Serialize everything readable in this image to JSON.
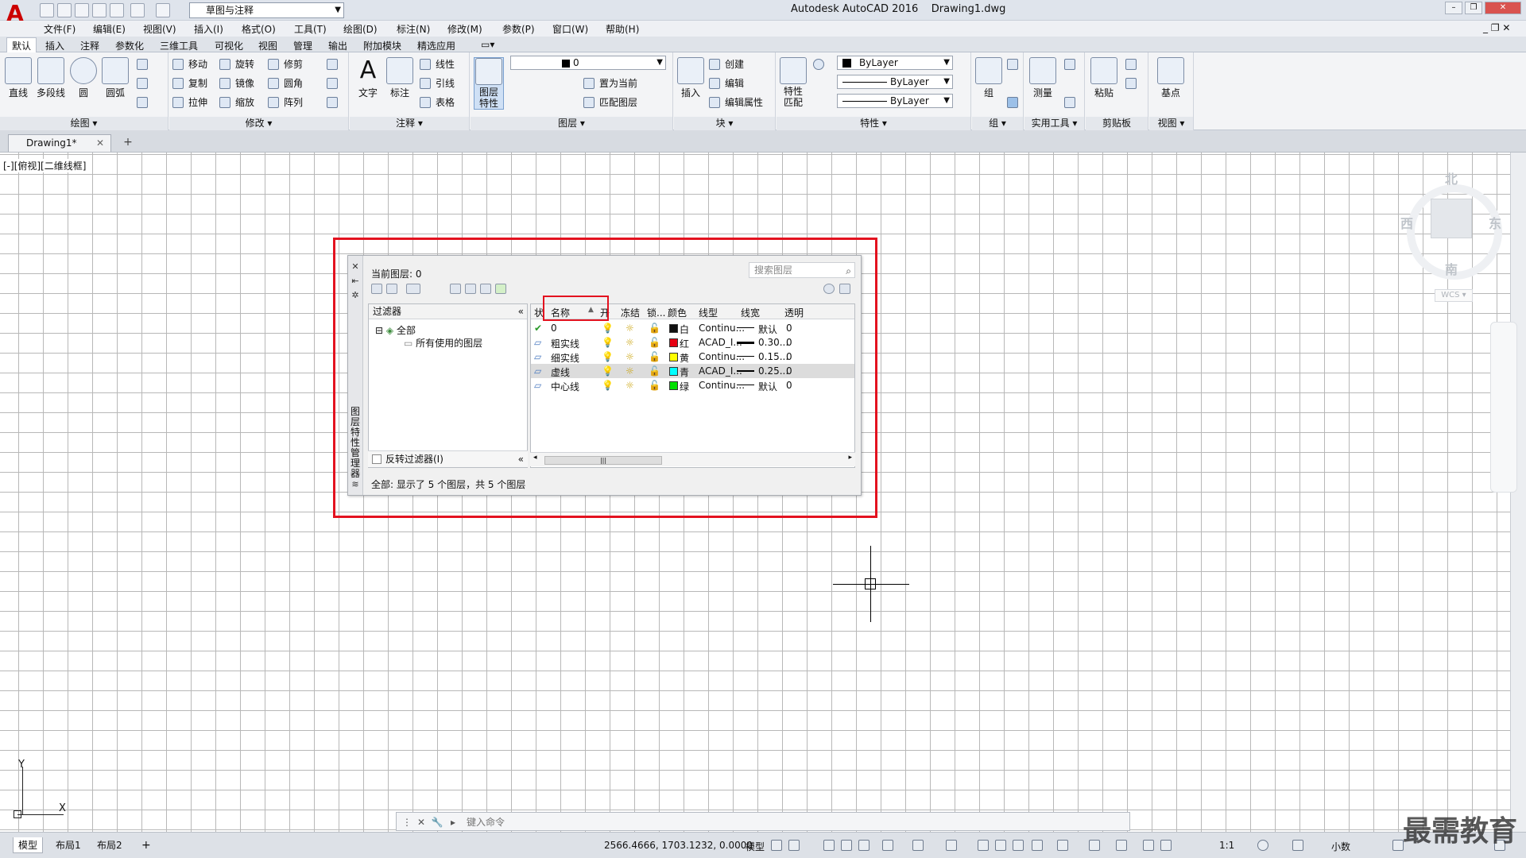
{
  "titlebar": {
    "workspace": "草图与注释",
    "app_title": "Autodesk AutoCAD 2016",
    "doc_title": "Drawing1.dwg"
  },
  "menu": [
    "文件(F)",
    "编辑(E)",
    "视图(V)",
    "插入(I)",
    "格式(O)",
    "工具(T)",
    "绘图(D)",
    "标注(N)",
    "修改(M)",
    "参数(P)",
    "窗口(W)",
    "帮助(H)"
  ],
  "ribbon_tabs": [
    "默认",
    "插入",
    "注释",
    "参数化",
    "三维工具",
    "可视化",
    "视图",
    "管理",
    "输出",
    "附加模块",
    "精选应用"
  ],
  "ribbon": {
    "draw": {
      "title": "绘图",
      "buttons": [
        "直线",
        "多段线",
        "圆",
        "圆弧"
      ]
    },
    "modify": {
      "title": "修改",
      "buttons": [
        "移动",
        "旋转",
        "修剪",
        "复制",
        "镜像",
        "圆角",
        "拉伸",
        "缩放",
        "阵列"
      ]
    },
    "annotate": {
      "title": "注释",
      "buttons": [
        "文字",
        "标注",
        "线性",
        "引线",
        "表格"
      ]
    },
    "layers": {
      "title": "图层",
      "big": "图层\n特性",
      "current": "0",
      "buttons": [
        "置为当前",
        "匹配图层"
      ]
    },
    "block": {
      "title": "块",
      "big": "插入",
      "buttons": [
        "创建",
        "编辑",
        "编辑属性"
      ]
    },
    "properties": {
      "title": "特性",
      "big": "特性\n匹配",
      "color": "ByLayer",
      "linetype": "ByLayer",
      "lineweight": "ByLayer"
    },
    "groups": {
      "title": "组",
      "big": "组"
    },
    "utilities": {
      "title": "实用工具",
      "big": "测量"
    },
    "clipboard": {
      "title": "剪贴板",
      "big": "粘贴"
    },
    "view": {
      "title": "视图",
      "big": "基点"
    }
  },
  "doc_tab": "Drawing1*",
  "viewport_label": "[-][俯视][二维线框]",
  "viewcube": {
    "north": "北",
    "south": "南",
    "east": "东",
    "west": "西",
    "wcs": "WCS"
  },
  "ucs": {
    "x": "X",
    "y": "Y"
  },
  "command": {
    "placeholder": "键入命令"
  },
  "status": {
    "layout_tabs": [
      "模型",
      "布局1",
      "布局2"
    ],
    "coords": "2566.4666, 1703.1232, 0.0000",
    "mode": "模型",
    "scale": "1:1",
    "units": "小数"
  },
  "watermark": "最需教育",
  "layer_manager": {
    "vertical_title": "图层特性管理器",
    "current_layer": "当前图层: 0",
    "search_placeholder": "搜索图层",
    "filter_header": "过滤器",
    "tree_all": "全部",
    "tree_used": "所有使用的图层",
    "invert_filter": "反转过滤器(I)",
    "columns": [
      "状",
      "名称",
      "开",
      "冻结",
      "锁...",
      "颜色",
      "线型",
      "线宽",
      "透明"
    ],
    "layers": [
      {
        "name": "0",
        "color_name": "白",
        "color_hex": "#111111",
        "linetype": "Continu...",
        "lineweight": "默认",
        "transparency": "0",
        "current": true
      },
      {
        "name": "粗实线",
        "color_name": "红",
        "color_hex": "#e60012",
        "linetype": "ACAD_I...",
        "lineweight": "0.30...",
        "transparency": "0"
      },
      {
        "name": "细实线",
        "color_name": "黄",
        "color_hex": "#ffff00",
        "linetype": "Continu...",
        "lineweight": "0.15...",
        "transparency": "0"
      },
      {
        "name": "虚线",
        "color_name": "青",
        "color_hex": "#00ffff",
        "linetype": "ACAD_I...",
        "lineweight": "0.25...",
        "transparency": "0",
        "selected": true
      },
      {
        "name": "中心线",
        "color_name": "绿",
        "color_hex": "#00e000",
        "linetype": "Continu...",
        "lineweight": "默认",
        "transparency": "0"
      }
    ],
    "status_text": "全部: 显示了 5 个图层，共 5 个图层"
  }
}
